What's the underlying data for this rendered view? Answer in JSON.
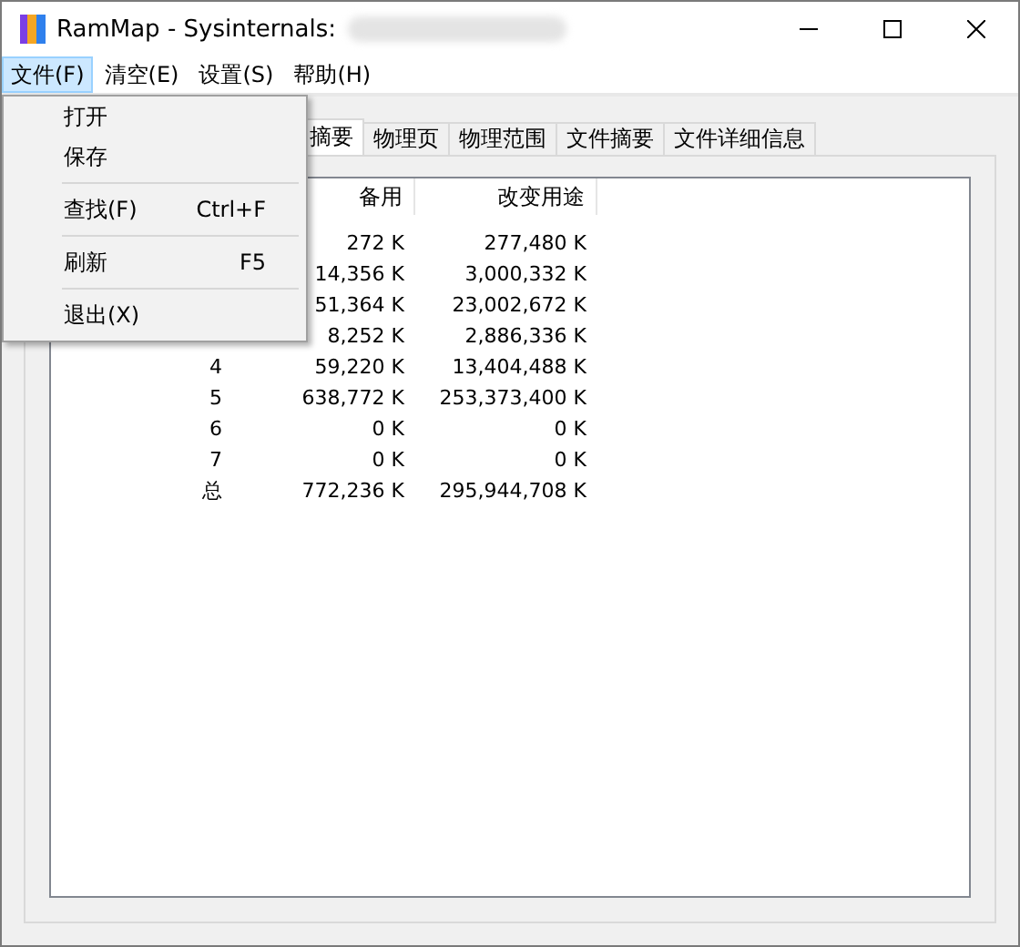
{
  "window": {
    "title": "RamMap - Sysinternals:"
  },
  "menu_bar": [
    {
      "label": "文件(F)",
      "selected": true
    },
    {
      "label": "清空(E)",
      "selected": false
    },
    {
      "label": "设置(S)",
      "selected": false
    },
    {
      "label": "帮助(H)",
      "selected": false
    }
  ],
  "open_menu": {
    "groups": [
      [
        {
          "label": "打开"
        },
        {
          "label": "保存"
        }
      ],
      [
        {
          "label": "查找(F)",
          "shortcut": "Ctrl+F"
        }
      ],
      [
        {
          "label": "刷新",
          "shortcut": "F5"
        }
      ],
      [
        {
          "label": "退出(X)"
        }
      ]
    ]
  },
  "tabs": [
    {
      "label": "摘要",
      "selected": true
    },
    {
      "label": "物理页",
      "selected": false
    },
    {
      "label": "物理范围",
      "selected": false
    },
    {
      "label": "文件摘要",
      "selected": false
    },
    {
      "label": "文件详细信息",
      "selected": false
    }
  ],
  "table": {
    "columns": [
      "",
      "备用",
      "改变用途"
    ],
    "rows": [
      [
        "",
        "272 K",
        "277,480 K"
      ],
      [
        "",
        "14,356 K",
        "3,000,332 K"
      ],
      [
        "",
        "51,364 K",
        "23,002,672 K"
      ],
      [
        "",
        "8,252 K",
        "2,886,336 K"
      ],
      [
        "4",
        "59,220 K",
        "13,404,488 K"
      ],
      [
        "5",
        "638,772 K",
        "253,373,400 K"
      ],
      [
        "6",
        "0 K",
        "0 K"
      ],
      [
        "7",
        "0 K",
        "0 K"
      ],
      [
        "总",
        "772,236 K",
        "295,944,708 K"
      ]
    ]
  }
}
